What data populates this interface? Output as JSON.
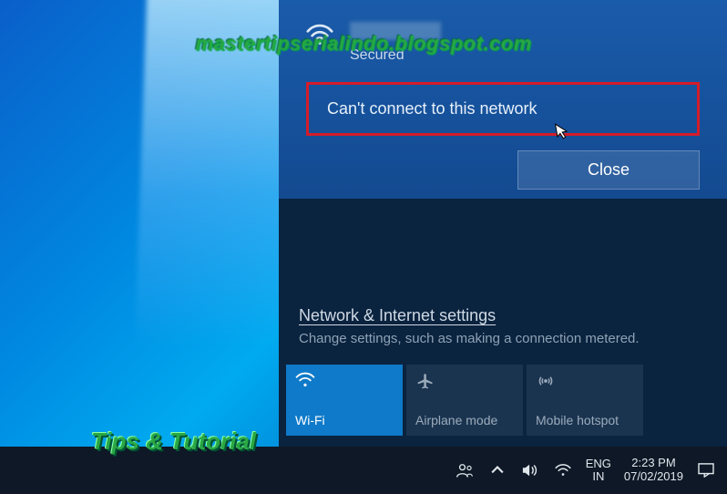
{
  "watermark": {
    "top": "mastertipserialindo.blogspot.com",
    "bottom": "Tips & Tutorial"
  },
  "network": {
    "secured_label": "Secured",
    "error_message": "Can't connect to this network",
    "close_label": "Close"
  },
  "settings": {
    "link_label": "Network & Internet settings",
    "description": "Change settings, such as making a connection metered."
  },
  "tiles": {
    "wifi": "Wi-Fi",
    "airplane": "Airplane mode",
    "hotspot": "Mobile hotspot"
  },
  "taskbar": {
    "lang_top": "ENG",
    "lang_bottom": "IN",
    "time": "2:23 PM",
    "date": "07/02/2019"
  }
}
